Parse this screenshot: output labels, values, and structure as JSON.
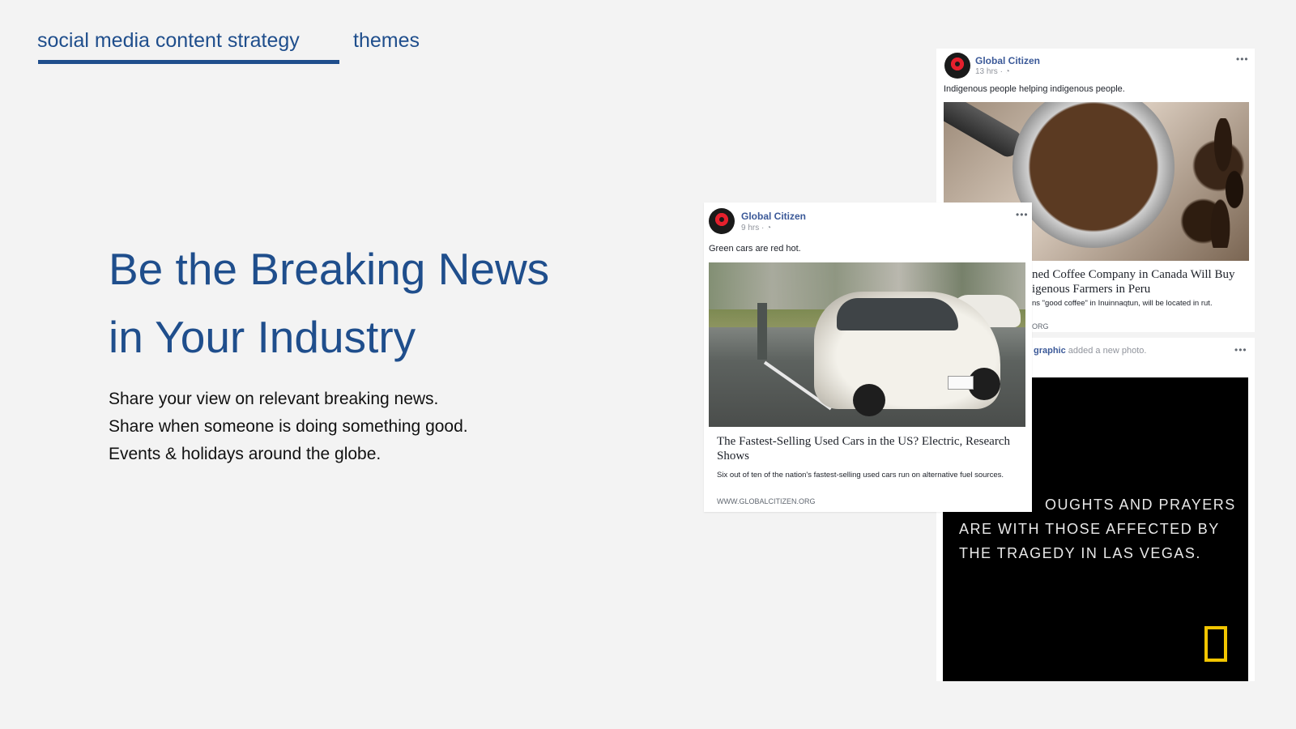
{
  "tabs": {
    "strategy_label": "social media content strategy",
    "themes_label": "themes"
  },
  "headline": {
    "line1": "Be the Breaking News",
    "line2": "in Your Industry"
  },
  "body": {
    "line1": "Share your view on relevant breaking news.",
    "line2": "Share when someone is doing something good.",
    "line3": "Events & holidays around the globe."
  },
  "posts": {
    "coffee": {
      "author": "Global Citizen",
      "time": "13 hrs · ",
      "text": "Indigenous people helping indigenous people.",
      "link_title": "ned Coffee Company in Canada Will Buy igenous Farmers in Peru",
      "link_desc": "ns \"good coffee\" in Inuinnaqtun, will be located in rut.",
      "domain": "ORG"
    },
    "natgeo": {
      "author": "graphic",
      "action": " added a new photo.",
      "image_text": [
        "OUGHTS AND PRAYERS",
        "ARE WITH THOSE AFFECTED BY",
        "THE TRAGEDY IN LAS VEGAS."
      ]
    },
    "cars": {
      "author": "Global Citizen",
      "time": "9 hrs · ",
      "text": "Green cars are red hot.",
      "link_title": "The Fastest-Selling Used Cars in the US? Electric, Research Shows",
      "link_desc": "Six out of ten of the nation's fastest-selling used cars run on alternative fuel sources.",
      "domain": "WWW.GLOBALCITIZEN.ORG"
    }
  },
  "colors": {
    "accent": "#1f4e8c",
    "background": "#f3f3f3",
    "facebook_link": "#3b5998",
    "natgeo_yellow": "#f2c500"
  },
  "icons": [
    "globe-icon",
    "more-options-icon",
    "natgeo-logo-icon",
    "global-citizen-avatar"
  ]
}
